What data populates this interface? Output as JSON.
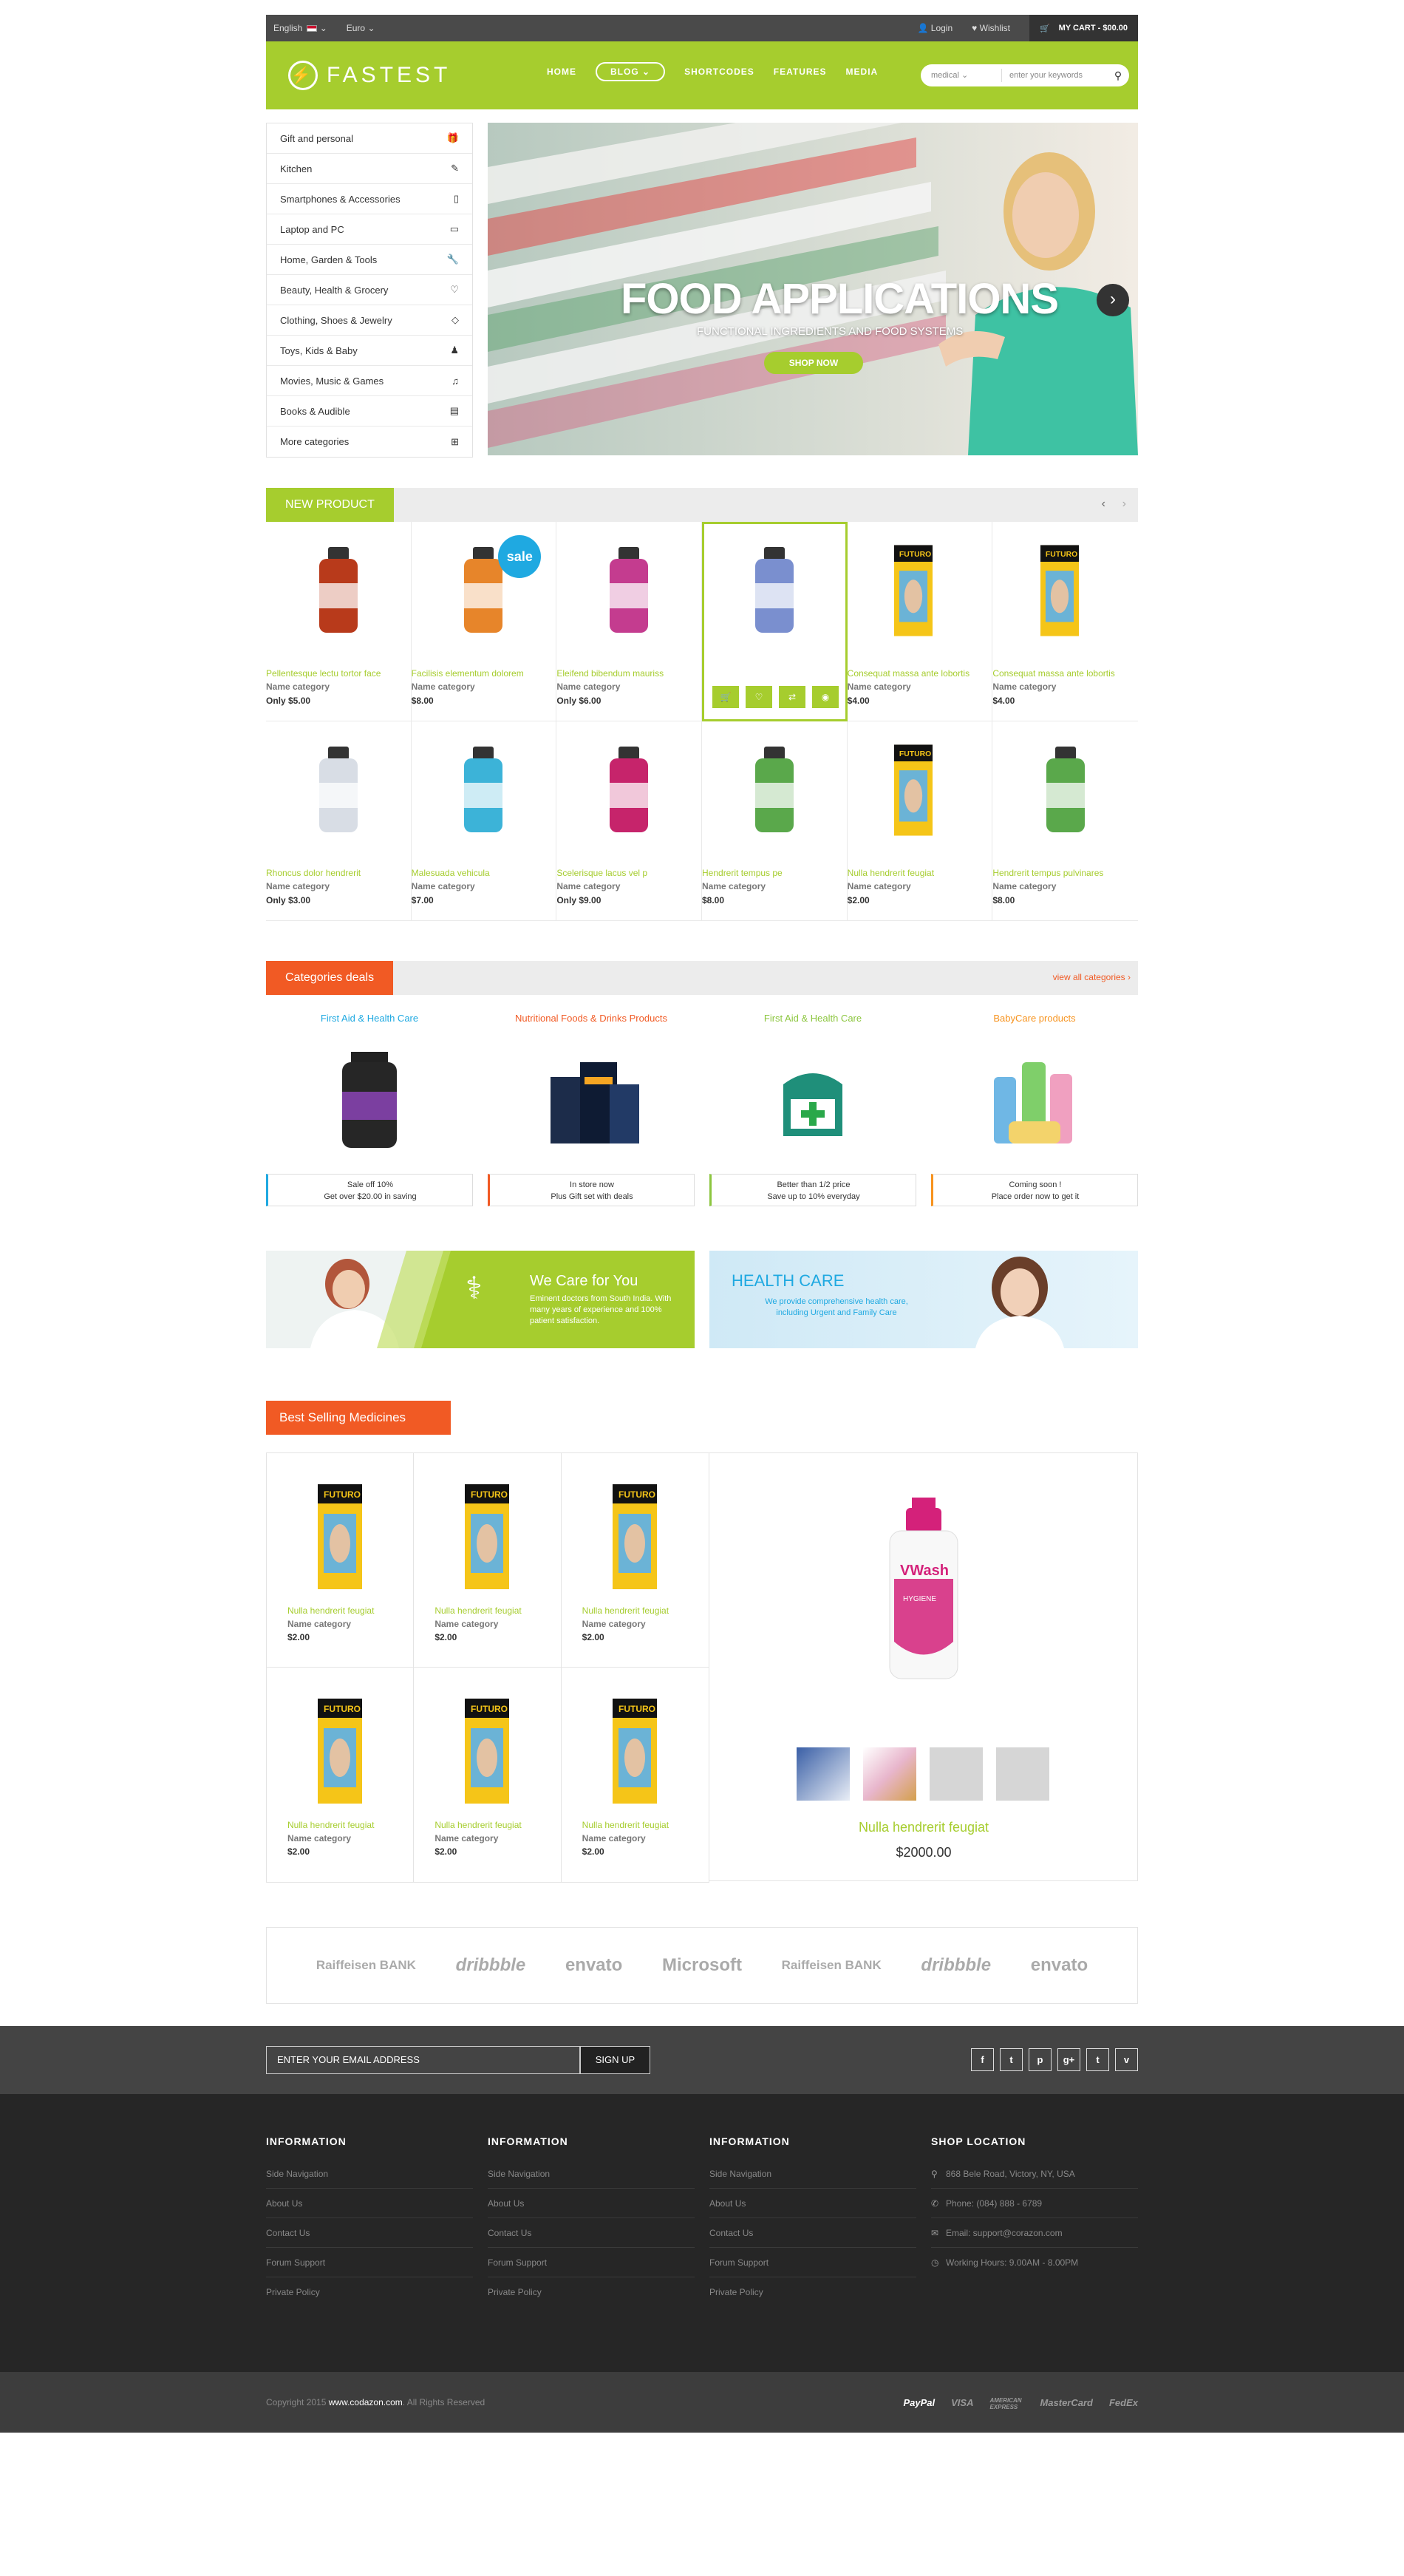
{
  "topbar": {
    "language": "English",
    "currency": "Euro",
    "login": "Login",
    "wishlist": "Wishlist",
    "cart": "MY CART - $00.00"
  },
  "header": {
    "logo": "FASTEST",
    "nav": [
      "HOME",
      "BLOG",
      "SHORTCODES",
      "FEATURES",
      "MEDIA"
    ],
    "search_category": "medical",
    "search_placeholder": "enter your keywords"
  },
  "sidebar": {
    "items": [
      {
        "label": "Gift and personal",
        "icon": "gift-icon",
        "glyph": "🎁"
      },
      {
        "label": "Kitchen",
        "icon": "spatula-icon",
        "glyph": "✎"
      },
      {
        "label": "Smartphones & Accessories",
        "icon": "phone-icon",
        "glyph": "▯"
      },
      {
        "label": "Laptop and PC",
        "icon": "laptop-icon",
        "glyph": "▭"
      },
      {
        "label": "Home, Garden & Tools",
        "icon": "wrench-icon",
        "glyph": "🔧"
      },
      {
        "label": "Beauty, Health & Grocery",
        "icon": "heart-icon",
        "glyph": "♡"
      },
      {
        "label": "Clothing, Shoes & Jewelry",
        "icon": "diamond-icon",
        "glyph": "◇"
      },
      {
        "label": "Toys, Kids & Baby",
        "icon": "baby-icon",
        "glyph": "♟"
      },
      {
        "label": "Movies, Music & Games",
        "icon": "music-icon",
        "glyph": "♫"
      },
      {
        "label": "Books & Audible",
        "icon": "book-icon",
        "glyph": "▤"
      },
      {
        "label": "More categories",
        "icon": "plus-box-icon",
        "glyph": "⊞"
      }
    ]
  },
  "banner": {
    "title": "FOOD APPLICATIONS",
    "subtitle": "FUNCTIONAL INGREDIENTS AND FOOD SYSTEMS",
    "button": "SHOP NOW"
  },
  "new_product": {
    "title": "NEW PRODUCT",
    "items": [
      {
        "name": "Pellentesque lectu tortor face",
        "category": "Name category",
        "price": "Only $5.00",
        "color": "#b83a1b"
      },
      {
        "name": "Facilisis elementum dolorem",
        "category": "Name category",
        "price": "$8.00",
        "color": "#e7852a",
        "sale": "sale"
      },
      {
        "name": "Eleifend bibendum mauriss",
        "category": "Name category",
        "price": "Only $6.00",
        "color": "#c43c8f"
      },
      {
        "name": "",
        "category": "",
        "price": "",
        "color": "#7a8fcf",
        "selected": true
      },
      {
        "name": "Consequat massa ante lobortis",
        "category": "Name category",
        "price": "$4.00",
        "color": "#f5c518"
      },
      {
        "name": "Consequat massa ante lobortis",
        "category": "Name category",
        "price": "$4.00",
        "color": "#f5c518"
      },
      {
        "name": "Rhoncus dolor hendrerit",
        "category": "Name category",
        "price": "Only $3.00",
        "color": "#d8dde5"
      },
      {
        "name": "Malesuada vehicula",
        "category": "Name category",
        "price": "$7.00",
        "color": "#3cb3d8"
      },
      {
        "name": "Scelerisque lacus vel p",
        "category": "Name category",
        "price": "Only $9.00",
        "color": "#c6246b"
      },
      {
        "name": "Hendrerit tempus pe",
        "category": "Name category",
        "price": "$8.00",
        "color": "#5aa84b"
      },
      {
        "name": "Nulla hendrerit feugiat",
        "category": "Name category",
        "price": "$2.00",
        "color": "#f5c518"
      },
      {
        "name": "Hendrerit tempus pulvinares",
        "category": "Name category",
        "price": "$8.00",
        "color": "#5aa84b"
      }
    ]
  },
  "categories_deals": {
    "title": "Categories deals",
    "view_all": "view all categories",
    "items": [
      {
        "title": "First Aid & Health Care",
        "line1": "Sale off 10%",
        "line2": "Get over $20.00 in saving",
        "color": "#1fa9e1"
      },
      {
        "title": "Nutritional Foods & Drinks Products",
        "line1": "In store now",
        "line2": "Plus Gift set with deals",
        "color": "#f15a24"
      },
      {
        "title": "First Aid & Health Care",
        "line1": "Better than 1/2 price",
        "line2": "Save up to 10% everyday",
        "color": "#8cc63f"
      },
      {
        "title": "BabyCare products",
        "line1": "Coming soon !",
        "line2": "Place order now to get it",
        "color": "#f7931e"
      }
    ]
  },
  "promos": [
    {
      "title": "We Care for You",
      "text": "Eminent doctors from South India. With many years of experience and 100% patient satisfaction."
    },
    {
      "title": "HEALTH CARE",
      "text": "We provide comprehensive health care, including Urgent and Family Care"
    }
  ],
  "best_selling": {
    "title": "Best Selling Medicines",
    "items": [
      {
        "name": "Nulla hendrerit feugiat",
        "category": "Name category",
        "price": "$2.00"
      },
      {
        "name": "Nulla hendrerit feugiat",
        "category": "Name category",
        "price": "$2.00"
      },
      {
        "name": "Nulla hendrerit feugiat",
        "category": "Name category",
        "price": "$2.00"
      },
      {
        "name": "Nulla hendrerit feugiat",
        "category": "Name category",
        "price": "$2.00"
      },
      {
        "name": "Nulla hendrerit feugiat",
        "category": "Name category",
        "price": "$2.00"
      },
      {
        "name": "Nulla hendrerit feugiat",
        "category": "Name category",
        "price": "$2.00"
      }
    ],
    "featured": {
      "name": "Nulla hendrerit feugiat",
      "price": "$2000.00",
      "brand": "VWash",
      "label": "HYGIENE"
    }
  },
  "brands": [
    "Raiffeisen BANK",
    "dribbble",
    "envato",
    "Microsoft",
    "Raiffeisen BANK",
    "dribbble",
    "envato"
  ],
  "newsletter": {
    "placeholder": "ENTER YOUR EMAIL ADDRESS",
    "button": "SIGN UP",
    "social": [
      "f",
      "t",
      "p",
      "g+",
      "t",
      "v"
    ]
  },
  "footer": {
    "columns": [
      {
        "title": "INFORMATION",
        "links": [
          "Side Navigation",
          "About Us",
          "Contact Us",
          "Forum Support",
          "Private Policy"
        ]
      },
      {
        "title": "INFORMATION",
        "links": [
          "Side Navigation",
          "About Us",
          "Contact Us",
          "Forum Support",
          "Private Policy"
        ]
      },
      {
        "title": "INFORMATION",
        "links": [
          "Side Navigation",
          "About Us",
          "Contact Us",
          "Forum Support",
          "Private Policy"
        ]
      }
    ],
    "shop": {
      "title": "SHOP LOCATION",
      "lines": [
        "868 Bele Road, Victory, NY, USA",
        "Phone: (084) 888 - 6789",
        "Email: support@corazon.com",
        "Working Hours: 9.00AM - 8.00PM"
      ]
    },
    "copyright": "Copyright 2015",
    "site": "www.codazon.com",
    "rights": ". All Rights Reserved",
    "payments": [
      "PayPal",
      "VISA",
      "AMERICAN EXPRESS",
      "MasterCard",
      "FedEx"
    ]
  },
  "colors": {
    "accent": "#a6cd2e",
    "orange": "#f15a24",
    "dark": "#262626"
  }
}
